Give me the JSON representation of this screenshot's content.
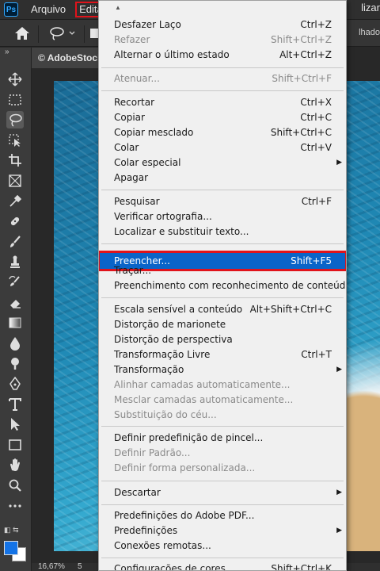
{
  "app": {
    "logo": "Ps"
  },
  "menubar": {
    "items": [
      "Arquivo",
      "Editar"
    ],
    "right_text": "lizar"
  },
  "options_bar": {
    "right_text": "lhado"
  },
  "tab": {
    "title": "© AdobeStock"
  },
  "status": {
    "zoom": "16,67%",
    "info": "5"
  },
  "colors": {
    "foreground": "#1473e6",
    "background": "#ffffff",
    "highlight": "#0a64c8",
    "annotation": "#e0131b"
  },
  "tools": [
    "move-icon",
    "marquee-icon",
    "lasso-icon",
    "object-select-icon",
    "crop-icon",
    "frame-icon",
    "eyedropper-icon",
    "healing-icon",
    "brush-icon",
    "clone-stamp-icon",
    "history-brush-icon",
    "eraser-icon",
    "gradient-icon",
    "blur-icon",
    "dodge-icon",
    "pen-icon",
    "type-icon",
    "path-select-icon",
    "rectangle-icon",
    "hand-icon",
    "zoom-icon",
    "more-icon"
  ],
  "edit_menu": {
    "items": [
      {
        "label": "Desfazer Laço",
        "shortcut": "Ctrl+Z"
      },
      {
        "label": "Refazer",
        "shortcut": "Shift+Ctrl+Z",
        "disabled": true
      },
      {
        "label": "Alternar o último estado",
        "shortcut": "Alt+Ctrl+Z"
      },
      {
        "label": "Atenuar...",
        "shortcut": "Shift+Ctrl+F",
        "disabled": true
      },
      {
        "label": "Recortar",
        "shortcut": "Ctrl+X"
      },
      {
        "label": "Copiar",
        "shortcut": "Ctrl+C"
      },
      {
        "label": "Copiar mesclado",
        "shortcut": "Shift+Ctrl+C"
      },
      {
        "label": "Colar",
        "shortcut": "Ctrl+V"
      },
      {
        "label": "Colar especial",
        "submenu": true
      },
      {
        "label": "Apagar"
      },
      {
        "label": "Pesquisar",
        "shortcut": "Ctrl+F"
      },
      {
        "label": "Verificar ortografia..."
      },
      {
        "label": "Localizar e substituir texto..."
      },
      {
        "label": "Preencher...",
        "shortcut": "Shift+F5",
        "highlighted": true
      },
      {
        "label": "Traçar..."
      },
      {
        "label": "Preenchimento com reconhecimento de conteúdo..."
      },
      {
        "label": "Escala sensível a conteúdo",
        "shortcut": "Alt+Shift+Ctrl+C"
      },
      {
        "label": "Distorção de marionete"
      },
      {
        "label": "Distorção de perspectiva"
      },
      {
        "label": "Transformação Livre",
        "shortcut": "Ctrl+T"
      },
      {
        "label": "Transformação",
        "submenu": true
      },
      {
        "label": "Alinhar camadas automaticamente...",
        "disabled": true
      },
      {
        "label": "Mesclar camadas automaticamente...",
        "disabled": true
      },
      {
        "label": "Substituição do céu...",
        "disabled": true
      },
      {
        "label": "Definir predefinição de pincel..."
      },
      {
        "label": "Definir Padrão...",
        "disabled": true
      },
      {
        "label": "Definir forma personalizada...",
        "disabled": true
      },
      {
        "label": "Descartar",
        "submenu": true
      },
      {
        "label": "Predefinições do Adobe PDF..."
      },
      {
        "label": "Predefinições",
        "submenu": true
      },
      {
        "label": "Conexões remotas..."
      },
      {
        "label": "Configurações de cores...",
        "shortcut": "Shift+Ctrl+K"
      }
    ]
  }
}
